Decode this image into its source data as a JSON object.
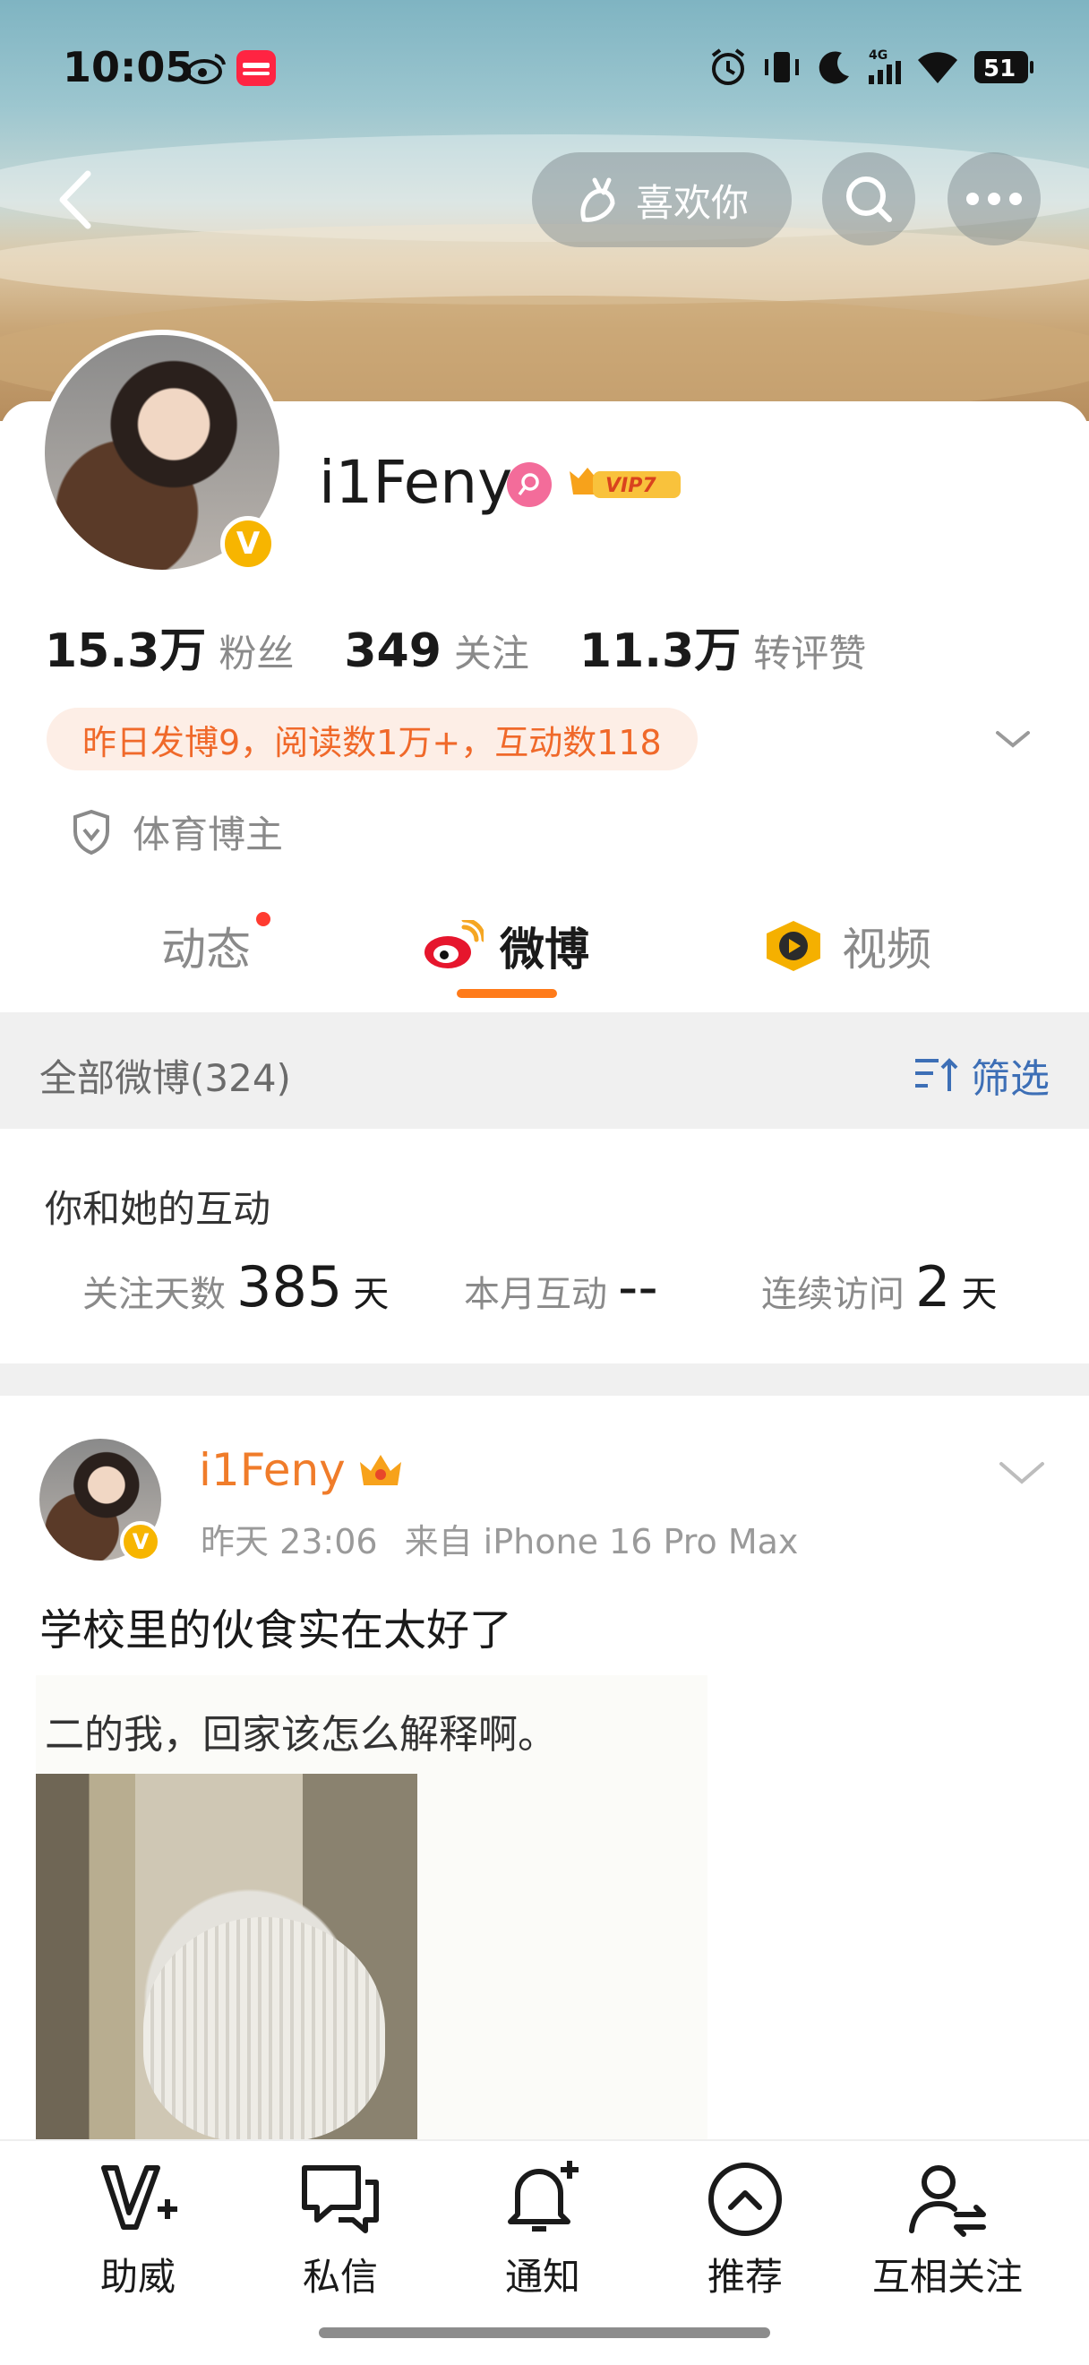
{
  "status_bar": {
    "time": "10:05",
    "battery": "51"
  },
  "header": {
    "like_label": "喜欢你"
  },
  "profile": {
    "name": "i1Feny",
    "vip_badge": "VIP7",
    "verified_mark": "V",
    "stats": [
      {
        "value": "15.3万",
        "label": "粉丝"
      },
      {
        "value": "349",
        "label": "关注"
      },
      {
        "value": "11.3万",
        "label": "转评赞"
      }
    ],
    "activity": "昨日发博9，阅读数1万+，互动数118",
    "tag": "体育博主"
  },
  "tabs": [
    {
      "label": "动态",
      "has_dot": true
    },
    {
      "label": "微博",
      "active": true
    },
    {
      "label": "视频"
    }
  ],
  "filter": {
    "all_label": "全部微博(324)",
    "filter_label": "筛选"
  },
  "interaction": {
    "title": "你和她的互动",
    "items": [
      {
        "label": "关注天数",
        "value": "385",
        "unit": "天"
      },
      {
        "label": "本月互动",
        "value": "--",
        "unit": ""
      },
      {
        "label": "连续访问",
        "value": "2",
        "unit": "天"
      }
    ]
  },
  "post": {
    "author": "i1Feny",
    "time": "昨天 23:06",
    "source": "来自 iPhone 16 Pro Max",
    "text": "学校里的伙食实在太好了",
    "image_caption": "二的我，回家该怎么解释啊。"
  },
  "bottom_bar": [
    {
      "label": "助威",
      "icon": "cheer-icon"
    },
    {
      "label": "私信",
      "icon": "message-icon"
    },
    {
      "label": "通知",
      "icon": "bell-plus-icon"
    },
    {
      "label": "推荐",
      "icon": "recommend-icon"
    },
    {
      "label": "互相关注",
      "icon": "mutual-follow-icon"
    }
  ],
  "colors": {
    "accent_orange": "#ff7b1a",
    "link_blue": "#3d6fb6",
    "vip_gold": "#f7b500"
  }
}
